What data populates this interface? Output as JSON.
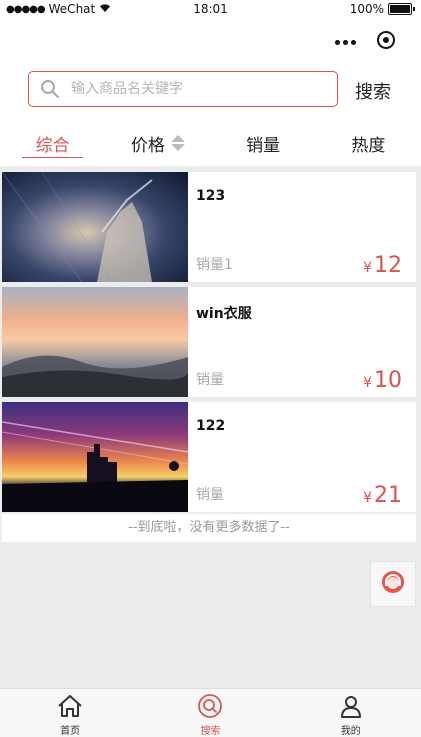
{
  "status_bar": {
    "carrier": "WeChat",
    "time": "18:01",
    "battery": "100%"
  },
  "search": {
    "placeholder": "输入商品名关键字",
    "button_label": "搜索"
  },
  "tabs": [
    {
      "label": "综合",
      "active": true
    },
    {
      "label": "价格",
      "active": false
    },
    {
      "label": "销量",
      "active": false
    },
    {
      "label": "热度",
      "active": false
    }
  ],
  "products": [
    {
      "title": "123",
      "sales": "销量1",
      "currency": "¥",
      "price": "12"
    },
    {
      "title": "win衣服",
      "sales": "销量",
      "currency": "¥",
      "price": "10"
    },
    {
      "title": "122",
      "sales": "销量",
      "currency": "¥",
      "price": "21"
    }
  ],
  "end_note": "--到底啦，没有更多数据了--",
  "tab_bar": [
    {
      "label": "首页",
      "icon": "home-icon",
      "active": false
    },
    {
      "label": "搜索",
      "icon": "search-icon",
      "active": true
    },
    {
      "label": "我的",
      "icon": "user-icon",
      "active": false
    }
  ],
  "colors": {
    "accent": "#d9534f",
    "page_background": "#ececec",
    "muted_text": "#aaaaaa"
  }
}
